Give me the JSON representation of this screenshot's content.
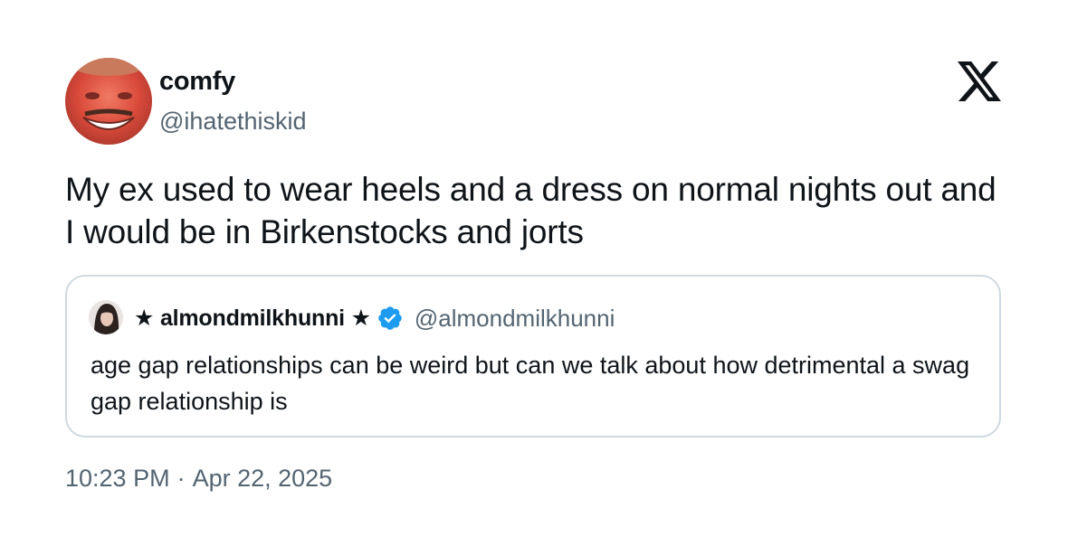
{
  "author": {
    "display_name": "comfy",
    "handle": "@ihatethiskid"
  },
  "icons": {
    "brand": "x-logo-icon",
    "verified": "verified-badge-icon",
    "verified_color": "#1d9bf0"
  },
  "tweet": {
    "text": "My ex used to wear heels and a dress on normal nights out and I would be in Birkenstocks and jorts"
  },
  "quoted_tweet": {
    "display_name": "★ almondmilkhunni ★",
    "handle": "@almondmilkhunni",
    "text": "age gap relationships can be weird but can we talk about how detrimental a swag gap relationship is"
  },
  "meta": {
    "time": "10:23 PM",
    "separator": "·",
    "date": "Apr 22, 2025"
  },
  "colors": {
    "text": "#0f1419",
    "secondary": "#536471",
    "border": "#cfd9de"
  }
}
